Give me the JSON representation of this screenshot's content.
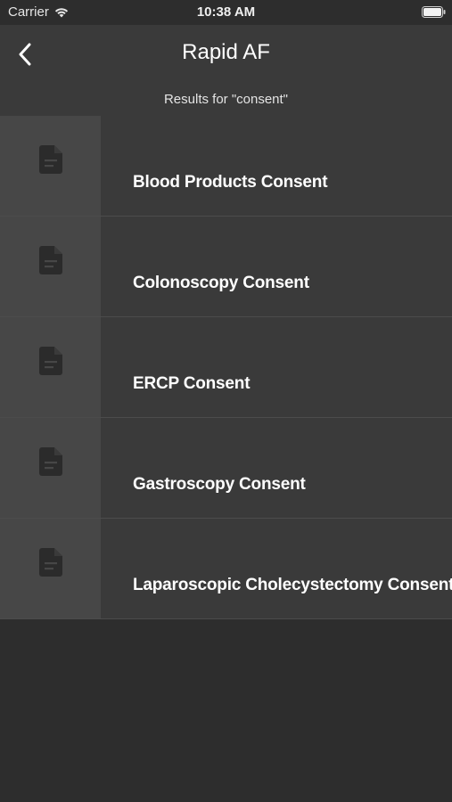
{
  "status_bar": {
    "carrier": "Carrier",
    "time": "10:38 AM"
  },
  "nav": {
    "title": "Rapid AF",
    "subtitle": "Results for \"consent\"",
    "back_icon": "chevron-left-icon"
  },
  "results": {
    "item_icon": "document-icon",
    "items": [
      {
        "label": "Blood Products Consent"
      },
      {
        "label": "Colonoscopy Consent"
      },
      {
        "label": "ERCP Consent"
      },
      {
        "label": "Gastroscopy Consent"
      },
      {
        "label": "Laparoscopic Cholecystectomy Consent"
      }
    ]
  },
  "colors": {
    "background": "#2d2d2d",
    "nav_background": "#3a3a3a",
    "thumb_background": "#474747",
    "icon": "#2b2b2b",
    "text": "#ffffff"
  }
}
